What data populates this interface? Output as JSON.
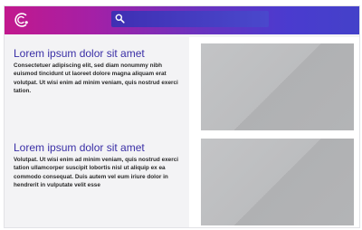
{
  "header": {
    "logo_icon": "stylized-c-logo-icon",
    "search": {
      "placeholder": "",
      "icon": "search-icon"
    }
  },
  "articles": [
    {
      "title": "Lorem ipsum dolor sit amet",
      "body": "Consectetuer adipiscing elit, sed diam nonummy nibh euismod tincidunt ut laoreet dolore magna aliquam erat volutpat. Ut wisi enim ad minim veniam, quis nostrud exerci tation."
    },
    {
      "title": "Lorem ipsum dolor sit amet",
      "body": "Volutpat. Ut wisi enim ad minim veniam, quis nostrud exerci tation ullamcorper suscipit lobortis nisl ut aliquip ex ea commodo consequat. Duis autem vel eum iriure dolor in hendrerit in vulputate velit esse"
    }
  ],
  "images": [
    "image-placeholder",
    "image-placeholder"
  ],
  "colors": {
    "header_gradient_start": "#c2188d",
    "header_gradient_end": "#4441c9",
    "title": "#3a2fa6",
    "placeholder": "#bcbdbf"
  }
}
